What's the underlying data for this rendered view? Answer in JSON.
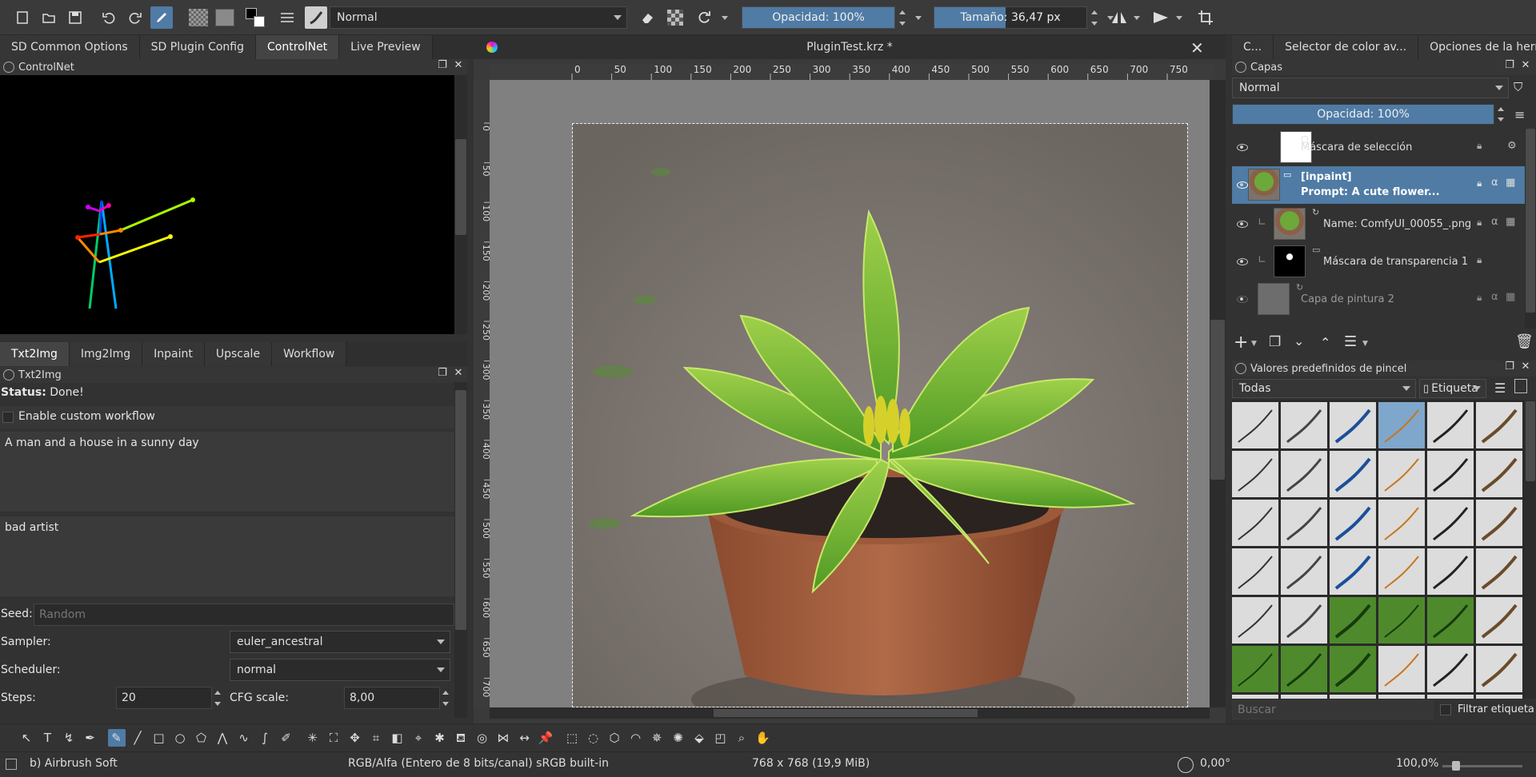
{
  "toolbar": {
    "blend_mode": "Normal",
    "opacity_label": "Opacidad: 100%",
    "opacity_value": 1.0,
    "size_label": "Tamaño: 36,47 px",
    "size_value": 0.47,
    "icons": [
      "new-document-icon",
      "open-folder-icon",
      "save-icon",
      "undo-icon",
      "redo-icon",
      "brush-editor-icon",
      "gradient-icon",
      "pattern-icon",
      "color-swatch-icon",
      "brush-presets-icon",
      "brush-preview-icon",
      "eraser-icon",
      "alpha-lock-icon",
      "reload-icon",
      "mirror-horizontal-icon",
      "mirror-vertical-icon",
      "crop-icon"
    ]
  },
  "left": {
    "top_tabs": [
      "SD Common Options",
      "SD Plugin Config",
      "ControlNet",
      "Live Preview"
    ],
    "top_active": 2,
    "controlnet_title": "ControlNet",
    "mode_tabs": [
      "Txt2Img",
      "Img2Img",
      "Inpaint",
      "Upscale",
      "Workflow"
    ],
    "mode_active": 0,
    "txt2img_title": "Txt2Img",
    "status_label": "Status:",
    "status_value": "Done!",
    "custom_workflow_label": "Enable custom workflow",
    "custom_workflow_checked": false,
    "prompt": "A man and a house in a sunny day",
    "negative_prompt": "bad artist",
    "seed_label": "Seed:",
    "seed_placeholder": "Random",
    "sampler_label": "Sampler:",
    "sampler_value": "euler_ancestral",
    "scheduler_label": "Scheduler:",
    "scheduler_value": "normal",
    "steps_label": "Steps:",
    "steps_value": "20",
    "cfg_label": "CFG scale:",
    "cfg_value": "8,00"
  },
  "canvas": {
    "title": "PluginTest.krz *",
    "ruler_h": [
      "0",
      "50",
      "100",
      "150",
      "200",
      "250",
      "300",
      "350",
      "400",
      "450",
      "500",
      "550",
      "600",
      "650",
      "700",
      "750"
    ],
    "ruler_v": [
      "0",
      "50",
      "100",
      "150",
      "200",
      "250",
      "300",
      "350",
      "400",
      "450",
      "500",
      "550",
      "600",
      "650",
      "700"
    ]
  },
  "right": {
    "top_tabs": [
      "C...",
      "Selector de color av...",
      "Opciones de la herra..."
    ],
    "layers_title": "Capas",
    "layers_blend": "Normal",
    "layers_opacity": "Opacidad:  100%",
    "layers": [
      {
        "name": "Máscara de selección",
        "sub": "",
        "selected": false
      },
      {
        "name": "[inpaint]",
        "sub": "Prompt: A cute flower...",
        "selected": true
      },
      {
        "name": "Name: ComfyUI_00055_.png",
        "sub": "",
        "selected": false
      },
      {
        "name": "Máscara de transparencia 1",
        "sub": "",
        "selected": false
      },
      {
        "name": "Capa de pintura 2",
        "sub": "",
        "selected": false
      }
    ],
    "brushes_title": "Valores predefinidos de pincel",
    "brushes_filter": "Todas",
    "brushes_tag": "Etiqueta",
    "search_placeholder": "Buscar",
    "filter_tag_label": "Filtrar etiqueta"
  },
  "status": {
    "brush": "b) Airbrush Soft",
    "color": "RGB/Alfa (Entero de 8 bits/canal)  sRGB built-in",
    "size": "768 x 768 (19,9 MiB)",
    "rotation": "0,00°",
    "zoom": "100,0%"
  },
  "colors": {
    "accent": "#4f7ba5",
    "panel": "#323232",
    "canvas_bg": "#808080"
  }
}
